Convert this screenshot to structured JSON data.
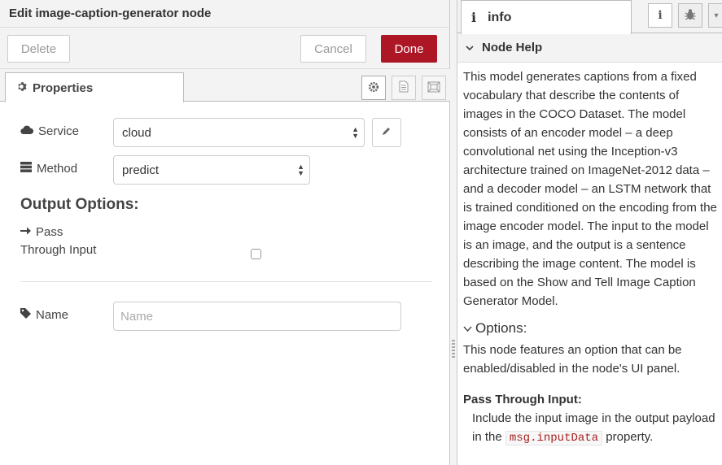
{
  "editor": {
    "title": "Edit image-caption-generator node",
    "buttons": {
      "delete": "Delete",
      "cancel": "Cancel",
      "done": "Done"
    },
    "tab": {
      "label": "Properties",
      "icon": "gear-icon"
    },
    "tab_icons": [
      "gear-icon",
      "document-icon",
      "frame-icon"
    ],
    "fields": {
      "service": {
        "label": "Service",
        "icon": "cloud-icon",
        "value": "cloud"
      },
      "method": {
        "label": "Method",
        "icon": "server-icon",
        "value": "predict"
      },
      "output_options": "Output Options:",
      "pass_through": {
        "label_line1": "Pass",
        "label_line2": "Through Input",
        "icon": "arrow-right-icon",
        "checked": false
      },
      "name": {
        "label": "Name",
        "icon": "tag-icon",
        "placeholder": "Name",
        "value": ""
      }
    }
  },
  "sidebar": {
    "tab_label": "info",
    "tab_icon": "info-icon",
    "tab_buttons": [
      "info-icon",
      "bug-icon",
      "chevron-down-icon"
    ],
    "section_title": "Node Help",
    "help": {
      "description": "This model generates captions from a fixed vocabulary that describe the contents of images in the COCO Dataset. The model consists of an encoder model – a deep convolutional net using the Inception-v3 architecture trained on ImageNet-2012 data – and a decoder model – an LSTM network that is trained conditioned on the encoding from the image encoder model. The input to the model is an image, and the output is a sentence describing the image content. The model is based on the Show and Tell Image Caption Generator Model.",
      "options_heading": "Options:",
      "options_text": "This node features an option that can be enabled/disabled in the node's UI panel.",
      "pass_through_title": "Pass Through Input:",
      "pass_through_text_before": "Include the input image in the output payload in the",
      "pass_through_code": "msg.inputData",
      "pass_through_text_after": "property."
    }
  }
}
